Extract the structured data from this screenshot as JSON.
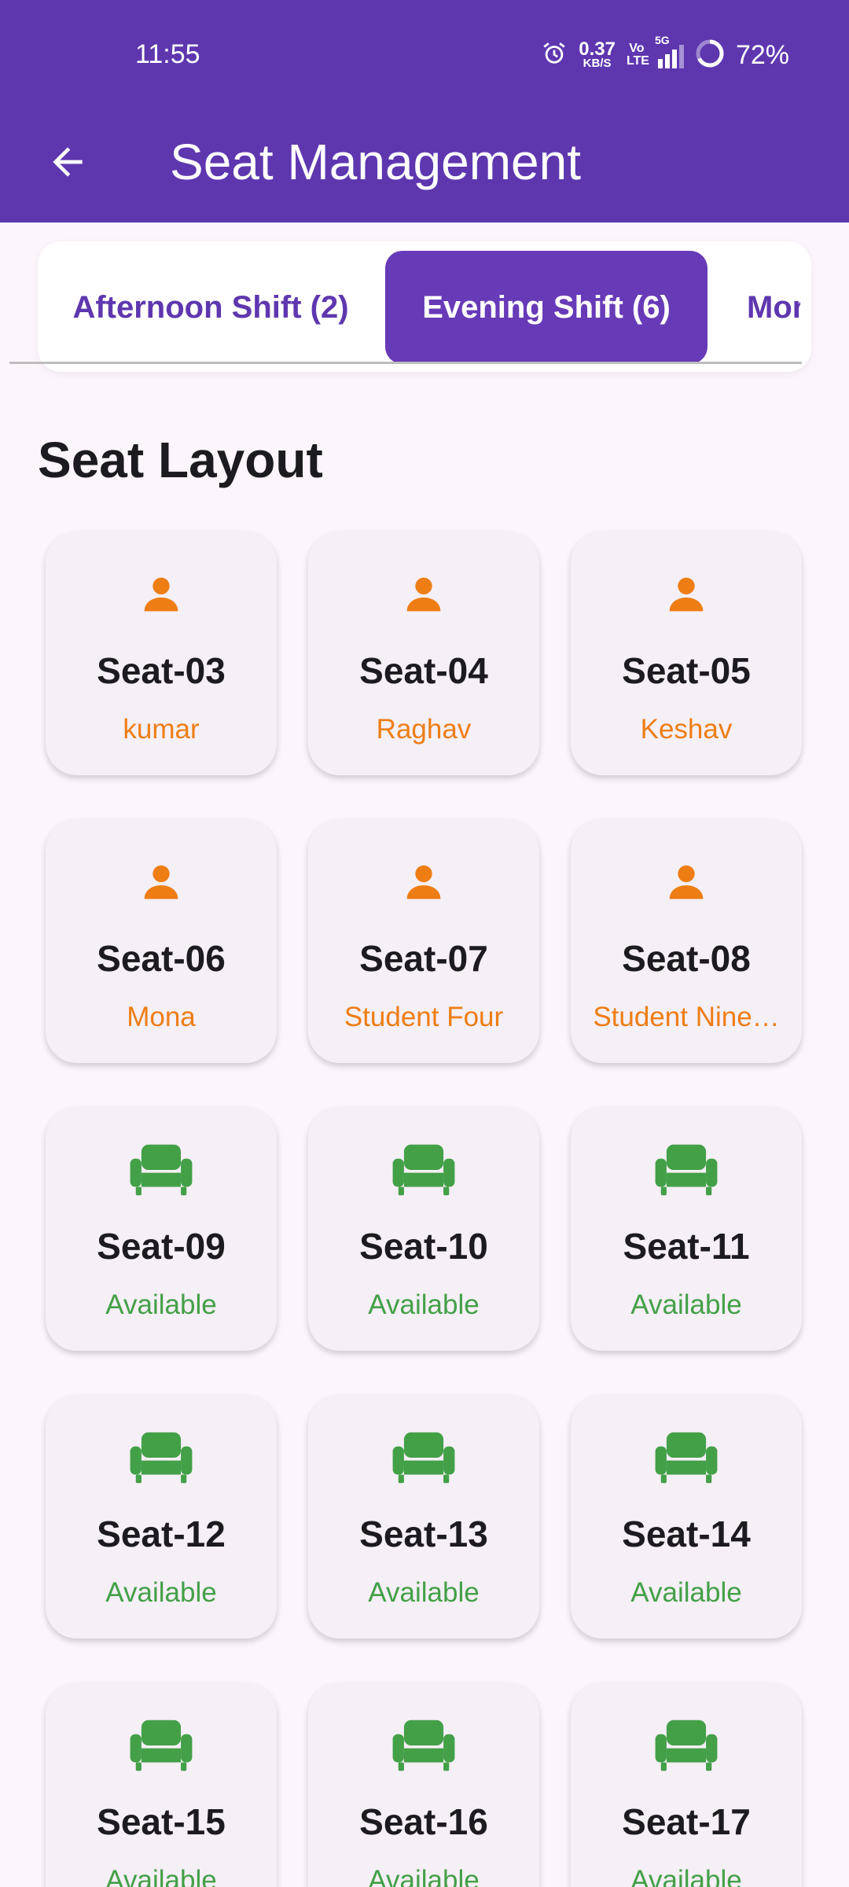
{
  "status_bar": {
    "time": "11:55",
    "net_speed": "0.37",
    "net_unit": "KB/S",
    "volte": "Vo LTE",
    "network": "5G",
    "battery": "72%"
  },
  "app_bar": {
    "title": "Seat Management",
    "back_icon": "arrow-back-icon"
  },
  "tabs": [
    {
      "label": "Afternoon Shift (2)",
      "selected": false
    },
    {
      "label": "Evening Shift (6)",
      "selected": true
    },
    {
      "label": "Mor",
      "selected": false
    }
  ],
  "section": {
    "title": "Seat Layout"
  },
  "colors": {
    "primary": "#5E37AF",
    "selected_tab": "#673AB7",
    "occupied": "#EE7D14",
    "available": "#43A047"
  },
  "seats": [
    {
      "name": "Seat-03",
      "status": "kumar",
      "occupied": true
    },
    {
      "name": "Seat-04",
      "status": "Raghav",
      "occupied": true
    },
    {
      "name": "Seat-05",
      "status": "Keshav",
      "occupied": true
    },
    {
      "name": "Seat-06",
      "status": "Mona",
      "occupied": true
    },
    {
      "name": "Seat-07",
      "status": "Student Four",
      "occupied": true
    },
    {
      "name": "Seat-08",
      "status": "Student Nine…",
      "occupied": true
    },
    {
      "name": "Seat-09",
      "status": "Available",
      "occupied": false
    },
    {
      "name": "Seat-10",
      "status": "Available",
      "occupied": false
    },
    {
      "name": "Seat-11",
      "status": "Available",
      "occupied": false
    },
    {
      "name": "Seat-12",
      "status": "Available",
      "occupied": false
    },
    {
      "name": "Seat-13",
      "status": "Available",
      "occupied": false
    },
    {
      "name": "Seat-14",
      "status": "Available",
      "occupied": false
    },
    {
      "name": "Seat-15",
      "status": "Available",
      "occupied": false
    },
    {
      "name": "Seat-16",
      "status": "Available",
      "occupied": false
    },
    {
      "name": "Seat-17",
      "status": "Available",
      "occupied": false
    }
  ]
}
